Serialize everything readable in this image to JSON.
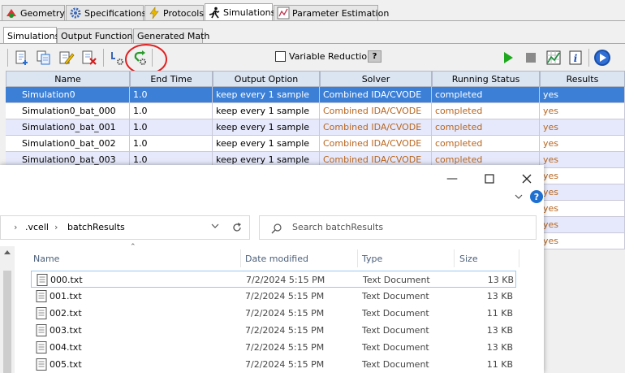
{
  "top_tabs": [
    {
      "label": "Geometry",
      "icon": "geometry-icon"
    },
    {
      "label": "Specifications",
      "icon": "gear-icon"
    },
    {
      "label": "Protocols",
      "icon": "lightning-icon"
    },
    {
      "label": "Simulations",
      "icon": "running-man-icon"
    },
    {
      "label": "Parameter Estimation",
      "icon": "chart-icon"
    }
  ],
  "sub_tabs": [
    "Simulations",
    "Output Functions",
    "Generated Math"
  ],
  "toolbar": {
    "variable_reduction_label": "Variable Reduction",
    "help_label": "?"
  },
  "table": {
    "headers": [
      "Name",
      "End Time",
      "Output Option",
      "Solver",
      "Running Status",
      "Results"
    ],
    "rows": [
      [
        "Simulation0",
        "1.0",
        "keep every 1 sample",
        "Combined IDA/CVODE",
        "completed",
        "yes"
      ],
      [
        "Simulation0_bat_000",
        "1.0",
        "keep every 1 sample",
        "Combined IDA/CVODE",
        "completed",
        "yes"
      ],
      [
        "Simulation0_bat_001",
        "1.0",
        "keep every 1 sample",
        "Combined IDA/CVODE",
        "completed",
        "yes"
      ],
      [
        "Simulation0_bat_002",
        "1.0",
        "keep every 1 sample",
        "Combined IDA/CVODE",
        "completed",
        "yes"
      ],
      [
        "Simulation0_bat_003",
        "1.0",
        "keep every 1 sample",
        "Combined IDA/CVODE",
        "completed",
        "yes"
      ]
    ],
    "hidden_results": [
      "yes",
      "yes",
      "yes",
      "yes",
      "yes"
    ]
  },
  "explorer": {
    "breadcrumb": [
      ".vcell",
      "batchResults"
    ],
    "search_placeholder": "Search batchResults",
    "columns": [
      "Name",
      "Date modified",
      "Type",
      "Size"
    ],
    "files": [
      {
        "name": "000.txt",
        "date": "7/2/2024 5:15 PM",
        "type": "Text Document",
        "size": "13 KB"
      },
      {
        "name": "001.txt",
        "date": "7/2/2024 5:15 PM",
        "type": "Text Document",
        "size": "13 KB"
      },
      {
        "name": "002.txt",
        "date": "7/2/2024 5:15 PM",
        "type": "Text Document",
        "size": "11 KB"
      },
      {
        "name": "003.txt",
        "date": "7/2/2024 5:15 PM",
        "type": "Text Document",
        "size": "13 KB"
      },
      {
        "name": "004.txt",
        "date": "7/2/2024 5:15 PM",
        "type": "Text Document",
        "size": "13 KB"
      },
      {
        "name": "005.txt",
        "date": "7/2/2024 5:15 PM",
        "type": "Text Document",
        "size": "11 KB"
      }
    ]
  },
  "colors": {
    "selection": "#3b7fd6",
    "status": "#b8651e",
    "annotation": "#e02020"
  }
}
